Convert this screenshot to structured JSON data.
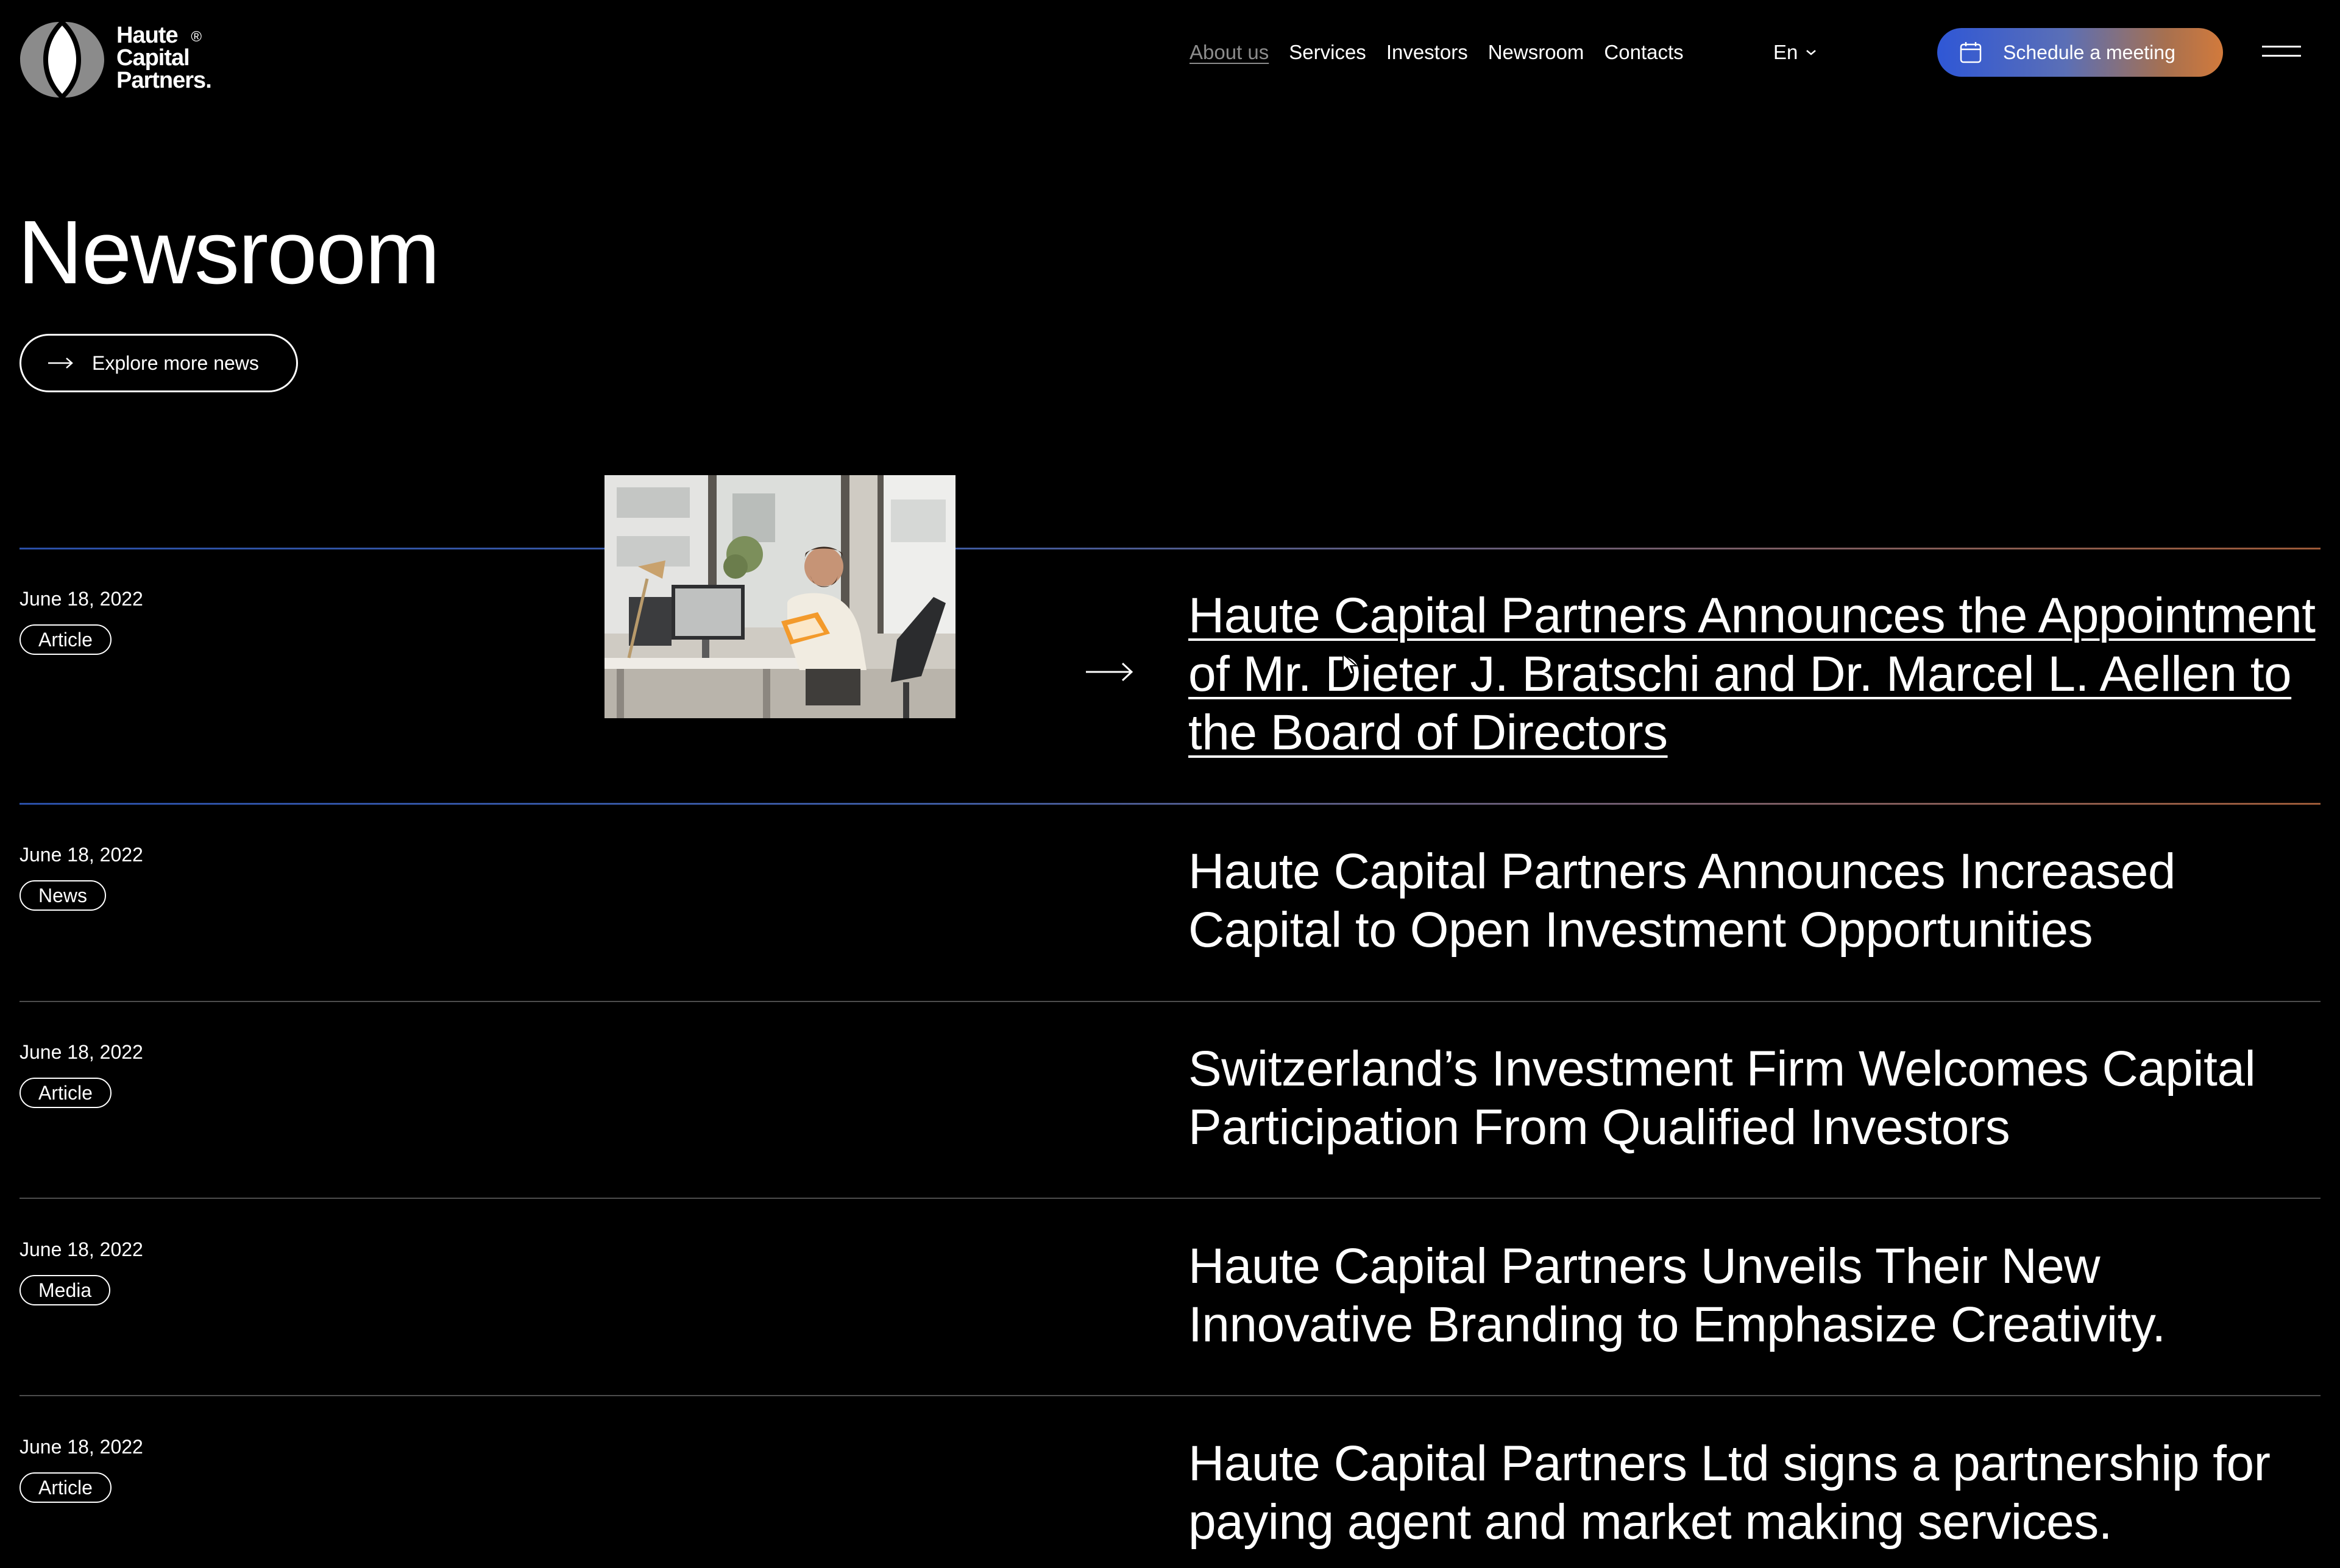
{
  "brand": {
    "name_lines": [
      "Haute",
      "Capital",
      "Partners."
    ],
    "registered_mark": "®"
  },
  "nav": {
    "items": [
      {
        "label": "About us",
        "active": true
      },
      {
        "label": "Services",
        "active": false
      },
      {
        "label": "Investors",
        "active": false
      },
      {
        "label": "Newsroom",
        "active": false
      },
      {
        "label": "Contacts",
        "active": false
      }
    ]
  },
  "language": {
    "current": "En"
  },
  "cta": {
    "label": "Schedule a meeting"
  },
  "page": {
    "title": "Newsroom",
    "explore_label": "Explore more news"
  },
  "news": [
    {
      "date": "June 18, 2022",
      "tag": "Article",
      "title": "Haute Capital Partners Announces the Appointment of Mr. Dieter J. Bratschi and Dr. Marcel L. Aellen to the Board of Directors"
    },
    {
      "date": "June 18, 2022",
      "tag": "News",
      "title": "Haute Capital Partners Announces Increased Capital to Open Investment Opportunities"
    },
    {
      "date": "June 18, 2022",
      "tag": "Article",
      "title": "Switzerland’s Investment Firm Welcomes Capital Participation From Qualified Investors"
    },
    {
      "date": "June 18, 2022",
      "tag": "Media",
      "title": "Haute Capital Partners Unveils Their New Innovative Branding to Emphasize Creativity."
    },
    {
      "date": "June 18, 2022",
      "tag": "Article",
      "title": "Haute Capital Partners Ltd signs a partnership for paying agent and market making services."
    }
  ],
  "colors": {
    "background": "#000000",
    "text": "#ffffff",
    "cta_gradient_start": "#2f57d6",
    "cta_gradient_end": "#d27a3c",
    "divider_gray": "#4d4d4d"
  },
  "icons": {
    "logo": "logo-mark-icon",
    "language_chevron": "chevron-down-icon",
    "cta": "calendar-icon",
    "menu": "hamburger-menu-icon",
    "explore": "arrow-right-icon",
    "item_arrow": "arrow-right-icon"
  }
}
